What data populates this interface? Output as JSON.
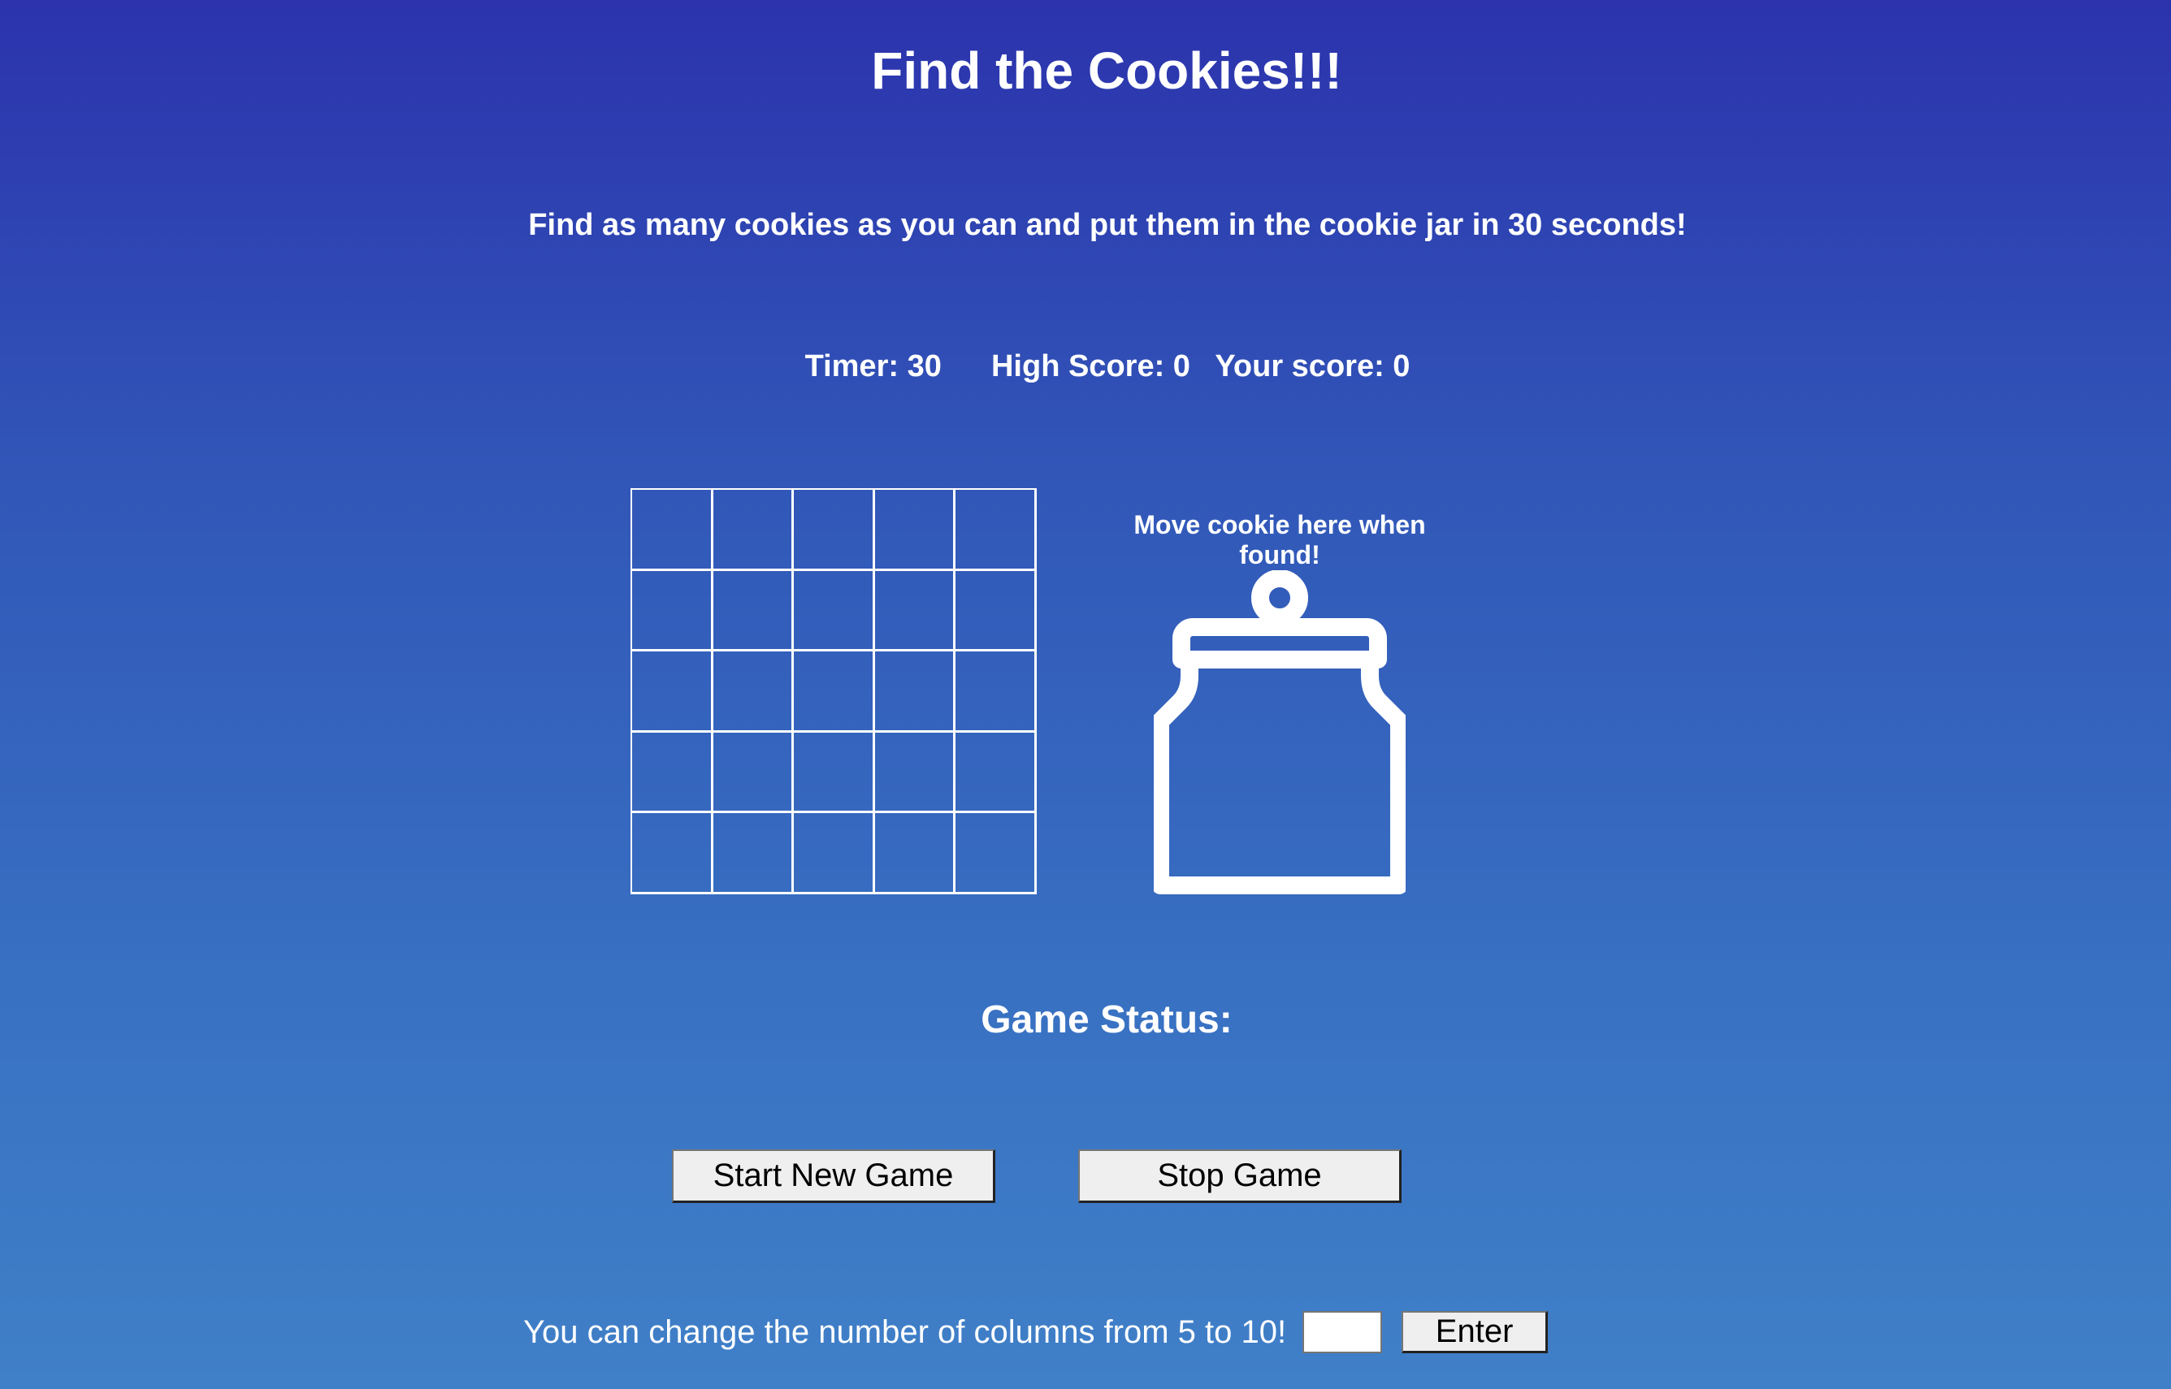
{
  "header": {
    "title": "Find the Cookies!!!",
    "instructions": "Find as many cookies as you can and put them in the cookie jar in 30 seconds!"
  },
  "scoreboard": {
    "timer_label": "Timer:",
    "timer_value": "30",
    "high_score_label": "High Score:",
    "high_score_value": "0",
    "your_score_label": "Your score:",
    "your_score_value": "0"
  },
  "board": {
    "columns": 5,
    "rows": 5
  },
  "jar": {
    "label": "Move cookie here when found!",
    "icon": "cookie-jar-icon"
  },
  "status": {
    "label": "Game Status:",
    "message": ""
  },
  "controls": {
    "start_label": "Start New Game",
    "stop_label": "Stop Game",
    "columns_prompt": "You can change the number of columns from 5 to 10!",
    "columns_value": "",
    "enter_label": "Enter"
  },
  "colors": {
    "background_top": "#2c33ad",
    "background_bottom": "#4080c8",
    "foreground": "#ffffff",
    "button_face": "#efefef"
  }
}
